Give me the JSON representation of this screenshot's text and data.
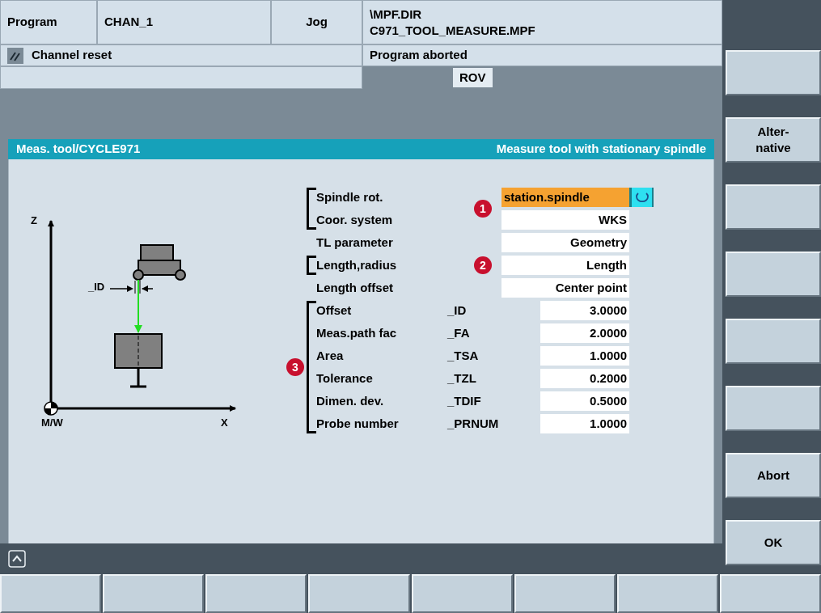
{
  "header": {
    "area": "Program",
    "channel": "CHAN_1",
    "mode": "Jog",
    "program_path": [
      "\\MPF.DIR",
      "C971_TOOL_MEASURE.MPF"
    ],
    "channel_status": "Channel reset",
    "program_status": "Program aborted",
    "indicator": "ROV"
  },
  "dialog": {
    "title": "Meas. tool/CYCLE971",
    "subtitle": "Measure tool with stationary spindle",
    "diagram": {
      "z_axis": "Z",
      "x_axis": "X",
      "origin": "M/W",
      "dimension": "_ID"
    },
    "groups": [
      {
        "bracketed": true,
        "callout": "1",
        "rows": [
          {
            "label": "Spindle rot.",
            "kind": "select",
            "value": "station.spindle",
            "focused": true
          },
          {
            "label": "Coor. system",
            "kind": "select",
            "value": "WKS",
            "focused": false
          }
        ]
      },
      {
        "bracketed": false,
        "rows": [
          {
            "label": "TL parameter",
            "kind": "select",
            "value": "Geometry",
            "focused": false
          }
        ]
      },
      {
        "bracketed": true,
        "callout": "2",
        "rows": [
          {
            "label": "Length,radius",
            "kind": "select",
            "value": "Length",
            "focused": false
          }
        ]
      },
      {
        "bracketed": false,
        "rows": [
          {
            "label": "Length offset",
            "kind": "select",
            "value": "Center point",
            "focused": false
          }
        ]
      },
      {
        "bracketed": true,
        "callout": "3",
        "rows": [
          {
            "label": "Offset",
            "kind": "number",
            "code": "_ID",
            "value": "3.0000",
            "focused": false
          },
          {
            "label": "Meas.path fac",
            "kind": "number",
            "code": "_FA",
            "value": "2.0000",
            "focused": false
          },
          {
            "label": "Area",
            "kind": "number",
            "code": "_TSA",
            "value": "1.0000",
            "focused": false
          },
          {
            "label": "Tolerance",
            "kind": "number",
            "code": "_TZL",
            "value": "0.2000",
            "focused": false
          },
          {
            "label": "Dimen. dev.",
            "kind": "number",
            "code": "_TDIF",
            "value": "0.5000",
            "focused": false
          },
          {
            "label": "Probe number",
            "kind": "number",
            "code": "_PRNUM",
            "value": "1.0000",
            "focused": false
          }
        ]
      }
    ]
  },
  "vertical_softkeys": [
    {
      "kind": "blank"
    },
    {
      "kind": "labeled",
      "label": [
        "Alter-",
        "native"
      ]
    },
    {
      "kind": "blank"
    },
    {
      "kind": "blank"
    },
    {
      "kind": "blank"
    },
    {
      "kind": "blank"
    },
    {
      "kind": "labeled",
      "label": [
        "Abort"
      ]
    },
    {
      "kind": "labeled",
      "label": [
        "OK"
      ]
    }
  ],
  "horizontal_softkeys": [
    {
      "kind": "blank"
    },
    {
      "kind": "blank"
    },
    {
      "kind": "blank"
    },
    {
      "kind": "blank"
    },
    {
      "kind": "blank"
    },
    {
      "kind": "blank"
    },
    {
      "kind": "blank"
    },
    {
      "kind": "blank"
    }
  ]
}
